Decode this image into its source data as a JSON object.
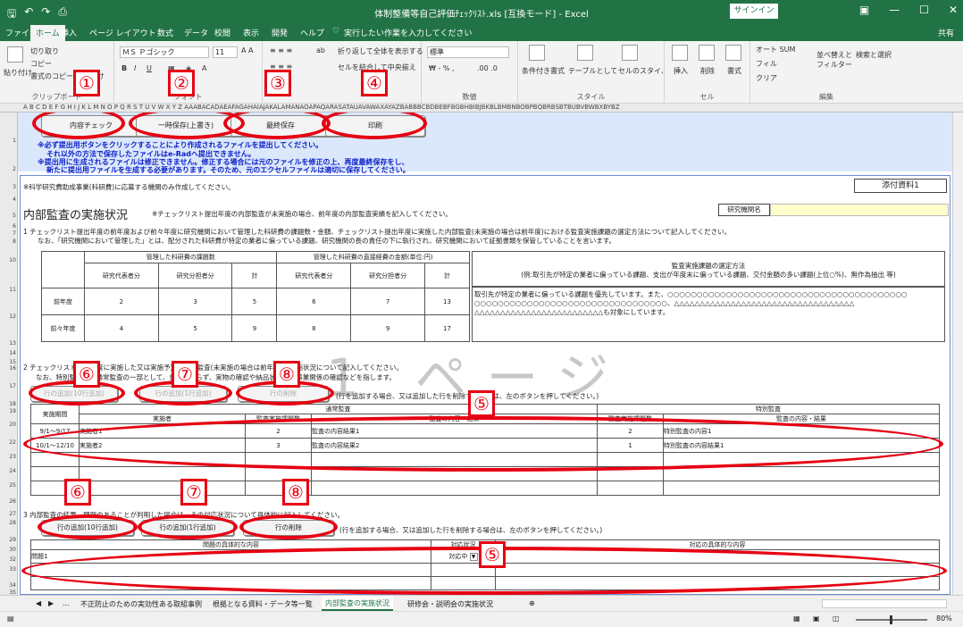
{
  "window": {
    "title": "体制整備等自己評価ﾁｪｯｸﾘｽﾄ.xls [互換モード] - Excel",
    "signin": "サインイン",
    "share": "共有"
  },
  "tabs": [
    "ファイル",
    "ホーム",
    "挿入",
    "ページ レイアウト",
    "数式",
    "データ",
    "校閲",
    "表示",
    "開発",
    "ヘルプ"
  ],
  "tell_me": "実行したい作業を入力してください",
  "ribbon": {
    "cut": "切り取り",
    "copy": "コピー",
    "paste": "貼り付け",
    "format_painter": "書式のコピー/貼り付け",
    "clipboard": "クリップボード",
    "font_name": "ＭＳ Ｐゴシック",
    "font_size": "11",
    "font_group": "フォント",
    "wrap": "折り返して全体を表示する",
    "merge": "セルを結合して中央揃え",
    "number_format": "標準",
    "number_group": "数値",
    "cond_format": "条件付き書式",
    "table_format": "テーブルとして書式設定",
    "cell_style": "セルのスタイル",
    "style_group": "スタイル",
    "insert": "挿入",
    "delete": "削除",
    "format": "書式",
    "cells_group": "セル",
    "autosum": "オート SUM",
    "fill": "フィル",
    "clear": "クリア",
    "sort": "並べ替えとフィルター",
    "find": "検索と選択",
    "edit_group": "編集"
  },
  "colhdr": "A    B          C                D                E      F  G  H  I  J  K  L  M  N  O  P  Q  R  S  T  U  V  W  X  Y  Z  AAABACADAEAFAGAHAIAJAKALAMANAOAPAQARASATAUAVAWAXAYAZBABBBCBDBEBFBGBHBIBJBKBLBMBNBOBPBQBRBSBTBUBVBWBXBYBZ",
  "rows": [
    "1",
    "2",
    "3",
    "4",
    "5",
    "6",
    "7",
    "8",
    "10",
    "11",
    "12",
    "13",
    "14",
    "15",
    "16",
    "17",
    "18",
    "19",
    "20",
    "22",
    "23",
    "24",
    "25",
    "26",
    "27",
    "28",
    "29",
    "30",
    "32",
    "33",
    "34",
    "35"
  ],
  "macro_buttons": [
    "内容チェック",
    "一時保存(上書き)",
    "最終保存",
    "印刷"
  ],
  "notes": [
    "※必ず提出用ボタンをクリックすることにより作成されるファイルを提出してください。",
    "それ以外の方法で保存したファイルはe-Radへ提出できません。",
    "※提出用に生成されるファイルは修正できません。修正する場合には元のファイルを修正の上、再度最終保存をし、",
    "新たに提出用ファイルを生成する必要があります。そのため、元のエクセルファイルは適切に保存してください。"
  ],
  "sheet": {
    "top_note": "※科学研究費助成事業(科研費)に応募する機関のみ作成してください。",
    "attachment": "添付資料1",
    "heading": "内部監査の実施状況",
    "heading_note": "※チェックリスト提出年度の内部監査が未実施の場合、前年度の内部監査実績を記入してください。",
    "institution_label": "研究機関名",
    "q1a": "1 チェックリスト提出年度の前年度および前々年度に研究機関において管理した科研費の課題数・金額、チェックリスト提出年度に実施した内部監査(未実施の場合は前年度)における監査実施課題の選定方法について記入してください。",
    "q1b": "なお、「研究機関において管理した」とは、配分された科研費が特定の業者に偏っている課題、研究機関の長の責任の下に執行され、研究機関において証拠書類を保管していることを言います。",
    "t1": {
      "h1": "管理した科研費の課題数",
      "h2": "管理した科研費の直接経費の金額(単位:円)",
      "cols": [
        "研究代表者分",
        "研究分担者分",
        "計",
        "研究代表者分",
        "研究分担者分",
        "計"
      ],
      "rows": [
        {
          "label": "前年度",
          "vals": [
            "2",
            "3",
            "5",
            "6",
            "7",
            "13"
          ]
        },
        {
          "label": "前々年度",
          "vals": [
            "4",
            "5",
            "9",
            "8",
            "9",
            "17"
          ]
        }
      ]
    },
    "sel_header": "監査実施課題の選定方法",
    "sel_example": "(例:取引先が特定の業者に偏っている課題、支出が年度末に偏っている課題、交付金額の多い課題(上位○%)、無作為抽出 等)",
    "sel_text1": "取引先が特定の業者に偏っている課題を優先しています。また、○○○○○○○○○○○○○○○○○○○○○○○○○○○○○○○○○○○○○○○○○",
    "sel_text2": "○○○○○○○○○○○○○○○○○○○○○○○○○○○○○○○○○、△△△△△△△△△△△△△△△△△△△△△△△△△△△△△△△△△△△",
    "sel_text3": "△△△△△△△△△△△△△△△△△△△△△△△△△も対象にしています。",
    "q2": "2 チェックリスト提出年度に実施した又は実施予定の内部監査(未実施の場合は前年度)の実施状況について記入してください。",
    "q2b": "なお、特別監査は、通常監査の一部として、書面によらず、実物の確認や納品状況等の事業関係の確認などを指します。",
    "row_btns": [
      "行の追加(10行追加)",
      "行の追加(1行追加)",
      "行の削除"
    ],
    "row_btn_note": "(行を追加する場合、又は追加した行を削除する場合は、左のボタンを押してください。)",
    "t2": {
      "normal": "通常監査",
      "special": "特別監査",
      "cols": [
        "実施期間",
        "実施者",
        "監査実施課題数",
        "監査の内容・結果",
        "監査実施課題数",
        "監査の内容・結果"
      ],
      "rows": [
        [
          "9/1～9/17",
          "実施者1",
          "2",
          "監査の内容結果1",
          "2",
          "特別監査の内容1"
        ],
        [
          "10/1～12/10",
          "実施者2",
          "3",
          "監査の内容結果2",
          "1",
          "特別監査の内容結果1"
        ]
      ]
    },
    "q3": "3 内部監査の結果、問題のあることが判明した場合は、その対応状況について具体的に記入してください。",
    "t3": {
      "cols": [
        "問題の具体的な内容",
        "対応状況",
        "対応の具体的な内容"
      ],
      "rows": [
        [
          "問題1",
          "対応中",
          ""
        ]
      ]
    },
    "watermark": "1 ページ"
  },
  "sheet_tabs": [
    "...",
    "不正防止のための実効性ある取組事例",
    "根拠となる資料・データ等一覧",
    "内部監査の実施状況",
    "研修会・説明会の実施状況"
  ],
  "zoom": "80%",
  "callouts": [
    "①",
    "②",
    "③",
    "④",
    "⑤",
    "⑥",
    "⑦",
    "⑧"
  ],
  "colors": {
    "excel_green": "#217346",
    "callout_red": "#e60012",
    "band_blue": "#dbe7fb",
    "note_blue": "#0a1fc9"
  }
}
